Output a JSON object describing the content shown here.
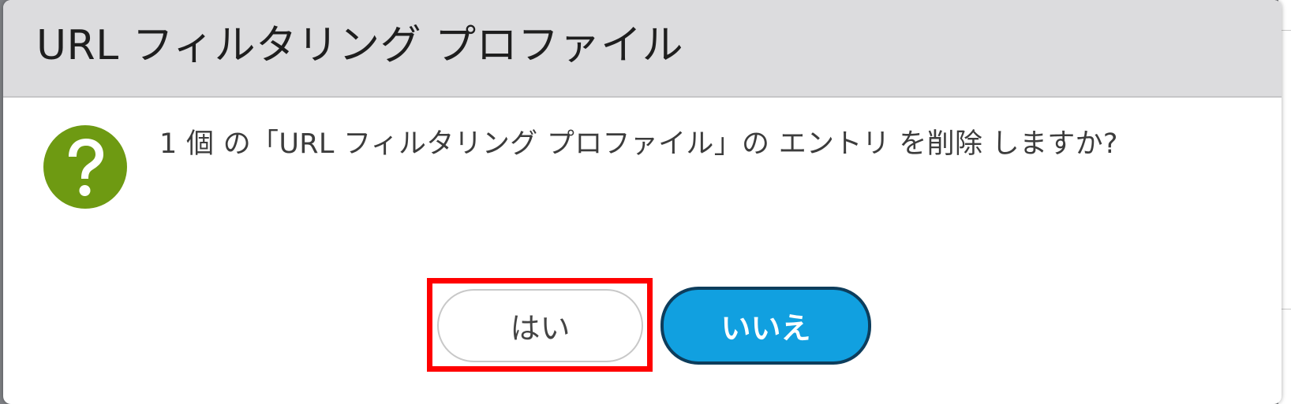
{
  "dialog": {
    "title": "URL フィルタリング プロファイル",
    "message": "1 個 の「URL フィルタリング プロファイル」の エントリ を削除 しますか?",
    "icon": "question-icon",
    "buttons": {
      "yes_label": "はい",
      "no_label": "いいえ"
    }
  },
  "colors": {
    "header_bg": "#dcdcde",
    "icon_green": "#6e9a12",
    "primary_button": "#11a0e0",
    "primary_button_border": "#0d3d5c",
    "highlight": "#ff0000"
  }
}
